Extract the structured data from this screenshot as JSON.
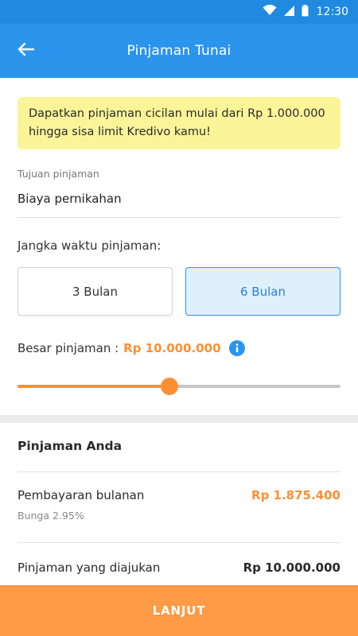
{
  "status_bar": {
    "time": "12:30"
  },
  "header": {
    "title": "Pinjaman Tunai"
  },
  "banner": {
    "text": "Dapatkan pinjaman cicilan mulai dari Rp 1.000.000 hingga sisa limit Kredivo kamu!"
  },
  "purpose": {
    "label": "Tujuan pinjaman",
    "value": "Biaya pernikahan"
  },
  "tenure": {
    "label": "Jangka waktu pinjaman:",
    "options": [
      {
        "label": "3 Bulan",
        "selected": false
      },
      {
        "label": "6 Bulan",
        "selected": true
      }
    ]
  },
  "amount": {
    "label": "Besar pinjaman :",
    "value": "Rp 10.000.000"
  },
  "slider": {
    "fraction": 0.47
  },
  "summary": {
    "title": "Pinjaman Anda",
    "monthly_label": "Pembayaran bulanan",
    "monthly_value": "Rp 1.875.400",
    "interest": "Bunga 2.95%",
    "requested_label": "Pinjaman yang diajukan",
    "requested_value": "Rp 10.000.000"
  },
  "cta": {
    "label": "LANJUT"
  },
  "colors": {
    "primary": "#2b95ee",
    "accent": "#ff8f33",
    "banner": "#fbf59a"
  },
  "icons": [
    "wifi-icon",
    "signal-icon",
    "battery-icon",
    "back-arrow-icon",
    "info-icon"
  ]
}
